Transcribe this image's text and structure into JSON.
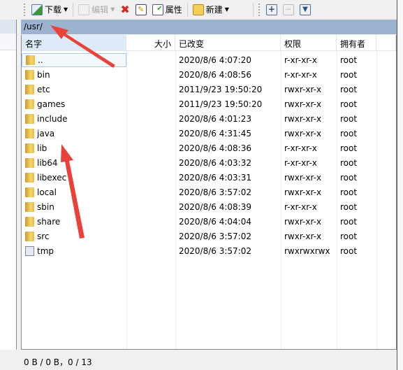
{
  "toolbar": {
    "download": "下载",
    "edit": "编辑",
    "properties": "属性",
    "new": "新建"
  },
  "path": "/usr/",
  "columns": {
    "name": "名字",
    "size": "大小",
    "modified": "已改变",
    "permissions": "权限",
    "owner": "拥有者"
  },
  "files": [
    {
      "name": "..",
      "size": "",
      "modified": "2020/8/6 4:07:20",
      "permissions": "r-xr-xr-x",
      "owner": "root",
      "icon": "parent-folder-icon"
    },
    {
      "name": "bin",
      "size": "",
      "modified": "2020/8/6 4:08:56",
      "permissions": "r-xr-xr-x",
      "owner": "root",
      "icon": "folder-icon"
    },
    {
      "name": "etc",
      "size": "",
      "modified": "2011/9/23 19:50:20",
      "permissions": "rwxr-xr-x",
      "owner": "root",
      "icon": "folder-icon"
    },
    {
      "name": "games",
      "size": "",
      "modified": "2011/9/23 19:50:20",
      "permissions": "rwxr-xr-x",
      "owner": "root",
      "icon": "folder-icon"
    },
    {
      "name": "include",
      "size": "",
      "modified": "2020/8/6 4:01:23",
      "permissions": "rwxr-xr-x",
      "owner": "root",
      "icon": "folder-icon"
    },
    {
      "name": "java",
      "size": "",
      "modified": "2020/8/6 4:31:45",
      "permissions": "rwxr-xr-x",
      "owner": "root",
      "icon": "folder-icon"
    },
    {
      "name": "lib",
      "size": "",
      "modified": "2020/8/6 4:08:36",
      "permissions": "r-xr-xr-x",
      "owner": "root",
      "icon": "folder-icon"
    },
    {
      "name": "lib64",
      "size": "",
      "modified": "2020/8/6 4:03:32",
      "permissions": "r-xr-xr-x",
      "owner": "root",
      "icon": "folder-icon"
    },
    {
      "name": "libexec",
      "size": "",
      "modified": "2020/8/6 4:03:31",
      "permissions": "rwxr-xr-x",
      "owner": "root",
      "icon": "folder-icon"
    },
    {
      "name": "local",
      "size": "",
      "modified": "2020/8/6 3:57:02",
      "permissions": "rwxr-xr-x",
      "owner": "root",
      "icon": "folder-icon"
    },
    {
      "name": "sbin",
      "size": "",
      "modified": "2020/8/6 4:08:39",
      "permissions": "r-xr-xr-x",
      "owner": "root",
      "icon": "folder-icon"
    },
    {
      "name": "share",
      "size": "",
      "modified": "2020/8/6 4:04:04",
      "permissions": "rwxr-xr-x",
      "owner": "root",
      "icon": "folder-icon"
    },
    {
      "name": "src",
      "size": "",
      "modified": "2020/8/6 3:57:02",
      "permissions": "rwxr-xr-x",
      "owner": "root",
      "icon": "folder-icon"
    },
    {
      "name": "tmp",
      "size": "",
      "modified": "2020/8/6 3:57:02",
      "permissions": "rwxrwxrwx",
      "owner": "root",
      "icon": "symlink-icon"
    }
  ],
  "status": "0 B / 0 B，0 / 13",
  "colors": {
    "path_bar": "#9bb3d0",
    "annotation_arrow": "#e8423a"
  }
}
